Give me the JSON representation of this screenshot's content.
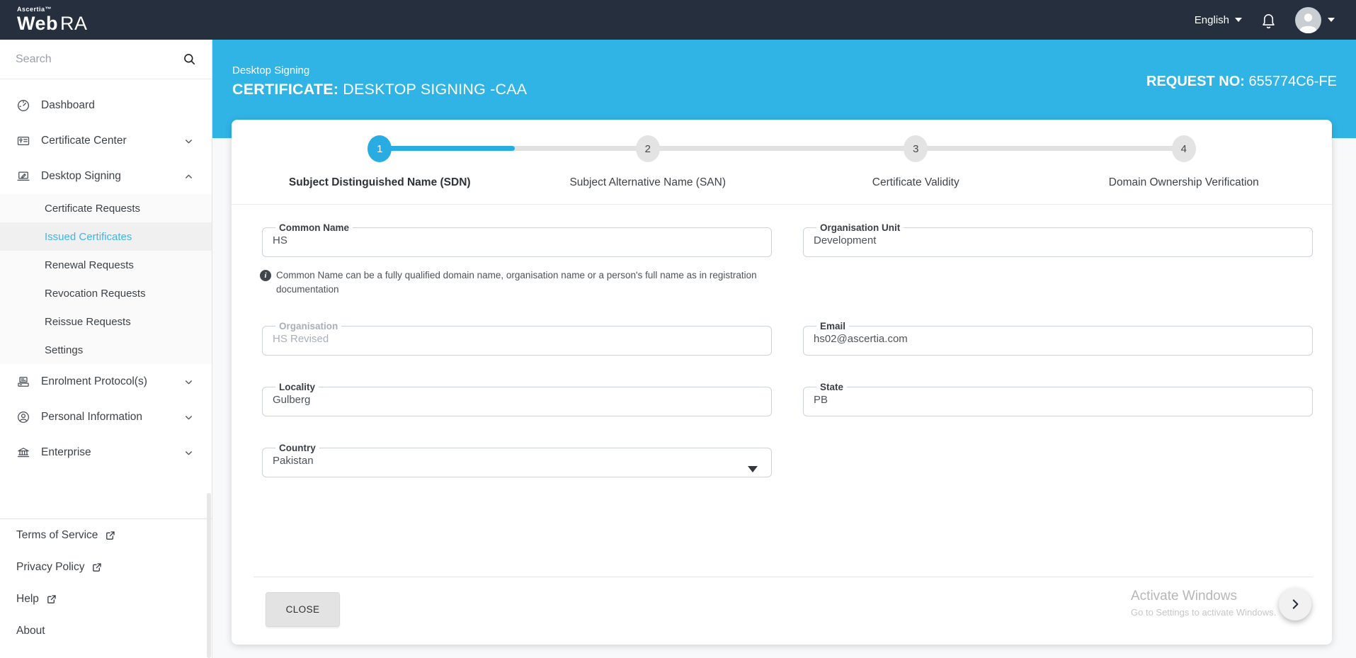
{
  "topbar": {
    "logo_brand": "Ascertia™",
    "logo_web": "Web",
    "logo_ra": "RA",
    "language": "English"
  },
  "sidebar": {
    "search_placeholder": "Search",
    "nav": [
      {
        "label": "Dashboard"
      },
      {
        "label": "Certificate Center"
      },
      {
        "label": "Desktop Signing"
      },
      {
        "label": "Enrolment Protocol(s)"
      },
      {
        "label": "Personal Information"
      },
      {
        "label": "Enterprise"
      }
    ],
    "submenu": [
      {
        "label": "Certificate Requests"
      },
      {
        "label": "Issued Certificates"
      },
      {
        "label": "Renewal Requests"
      },
      {
        "label": "Revocation Requests"
      },
      {
        "label": "Reissue Requests"
      },
      {
        "label": "Settings"
      }
    ],
    "footer_links": [
      {
        "label": "Terms of Service"
      },
      {
        "label": "Privacy Policy"
      },
      {
        "label": "Help"
      },
      {
        "label": "About"
      }
    ]
  },
  "hero": {
    "breadcrumb": "Desktop Signing",
    "title_label": "CERTIFICATE:",
    "title_value": " DESKTOP SIGNING -CAA",
    "request_label": "REQUEST NO:",
    "request_value": " 655774C6-FE"
  },
  "stepper": {
    "steps": [
      {
        "num": "1",
        "label": "Subject Distinguished Name (SDN)"
      },
      {
        "num": "2",
        "label": "Subject Alternative Name (SAN)"
      },
      {
        "num": "3",
        "label": "Certificate Validity"
      },
      {
        "num": "4",
        "label": "Domain Ownership Verification"
      }
    ]
  },
  "form": {
    "common_name": {
      "label": "Common Name",
      "value": "HS"
    },
    "organisation_unit": {
      "label": "Organisation Unit",
      "value": "Development"
    },
    "common_name_hint": "Common Name can be a fully qualified domain name, organisation name or a person's full name as in registration documentation",
    "hint_icon_glyph": "i",
    "organisation": {
      "label": "Organisation",
      "value": "HS Revised"
    },
    "email": {
      "label": "Email",
      "value": "hs02@ascertia.com"
    },
    "locality": {
      "label": "Locality",
      "value": "Gulberg"
    },
    "state": {
      "label": "State",
      "value": "PB"
    },
    "country": {
      "label": "Country",
      "value": "Pakistan"
    }
  },
  "footer": {
    "close_label": "CLOSE",
    "watermark_line1": "Activate Windows",
    "watermark_line2": "Go to Settings to activate Windows."
  },
  "colors": {
    "topbar_dark": "#252F3D",
    "header_cyan": "#2FB4E5",
    "accent_blue": "#29ACE1",
    "active_link_cyan": "#3FB5E8"
  }
}
